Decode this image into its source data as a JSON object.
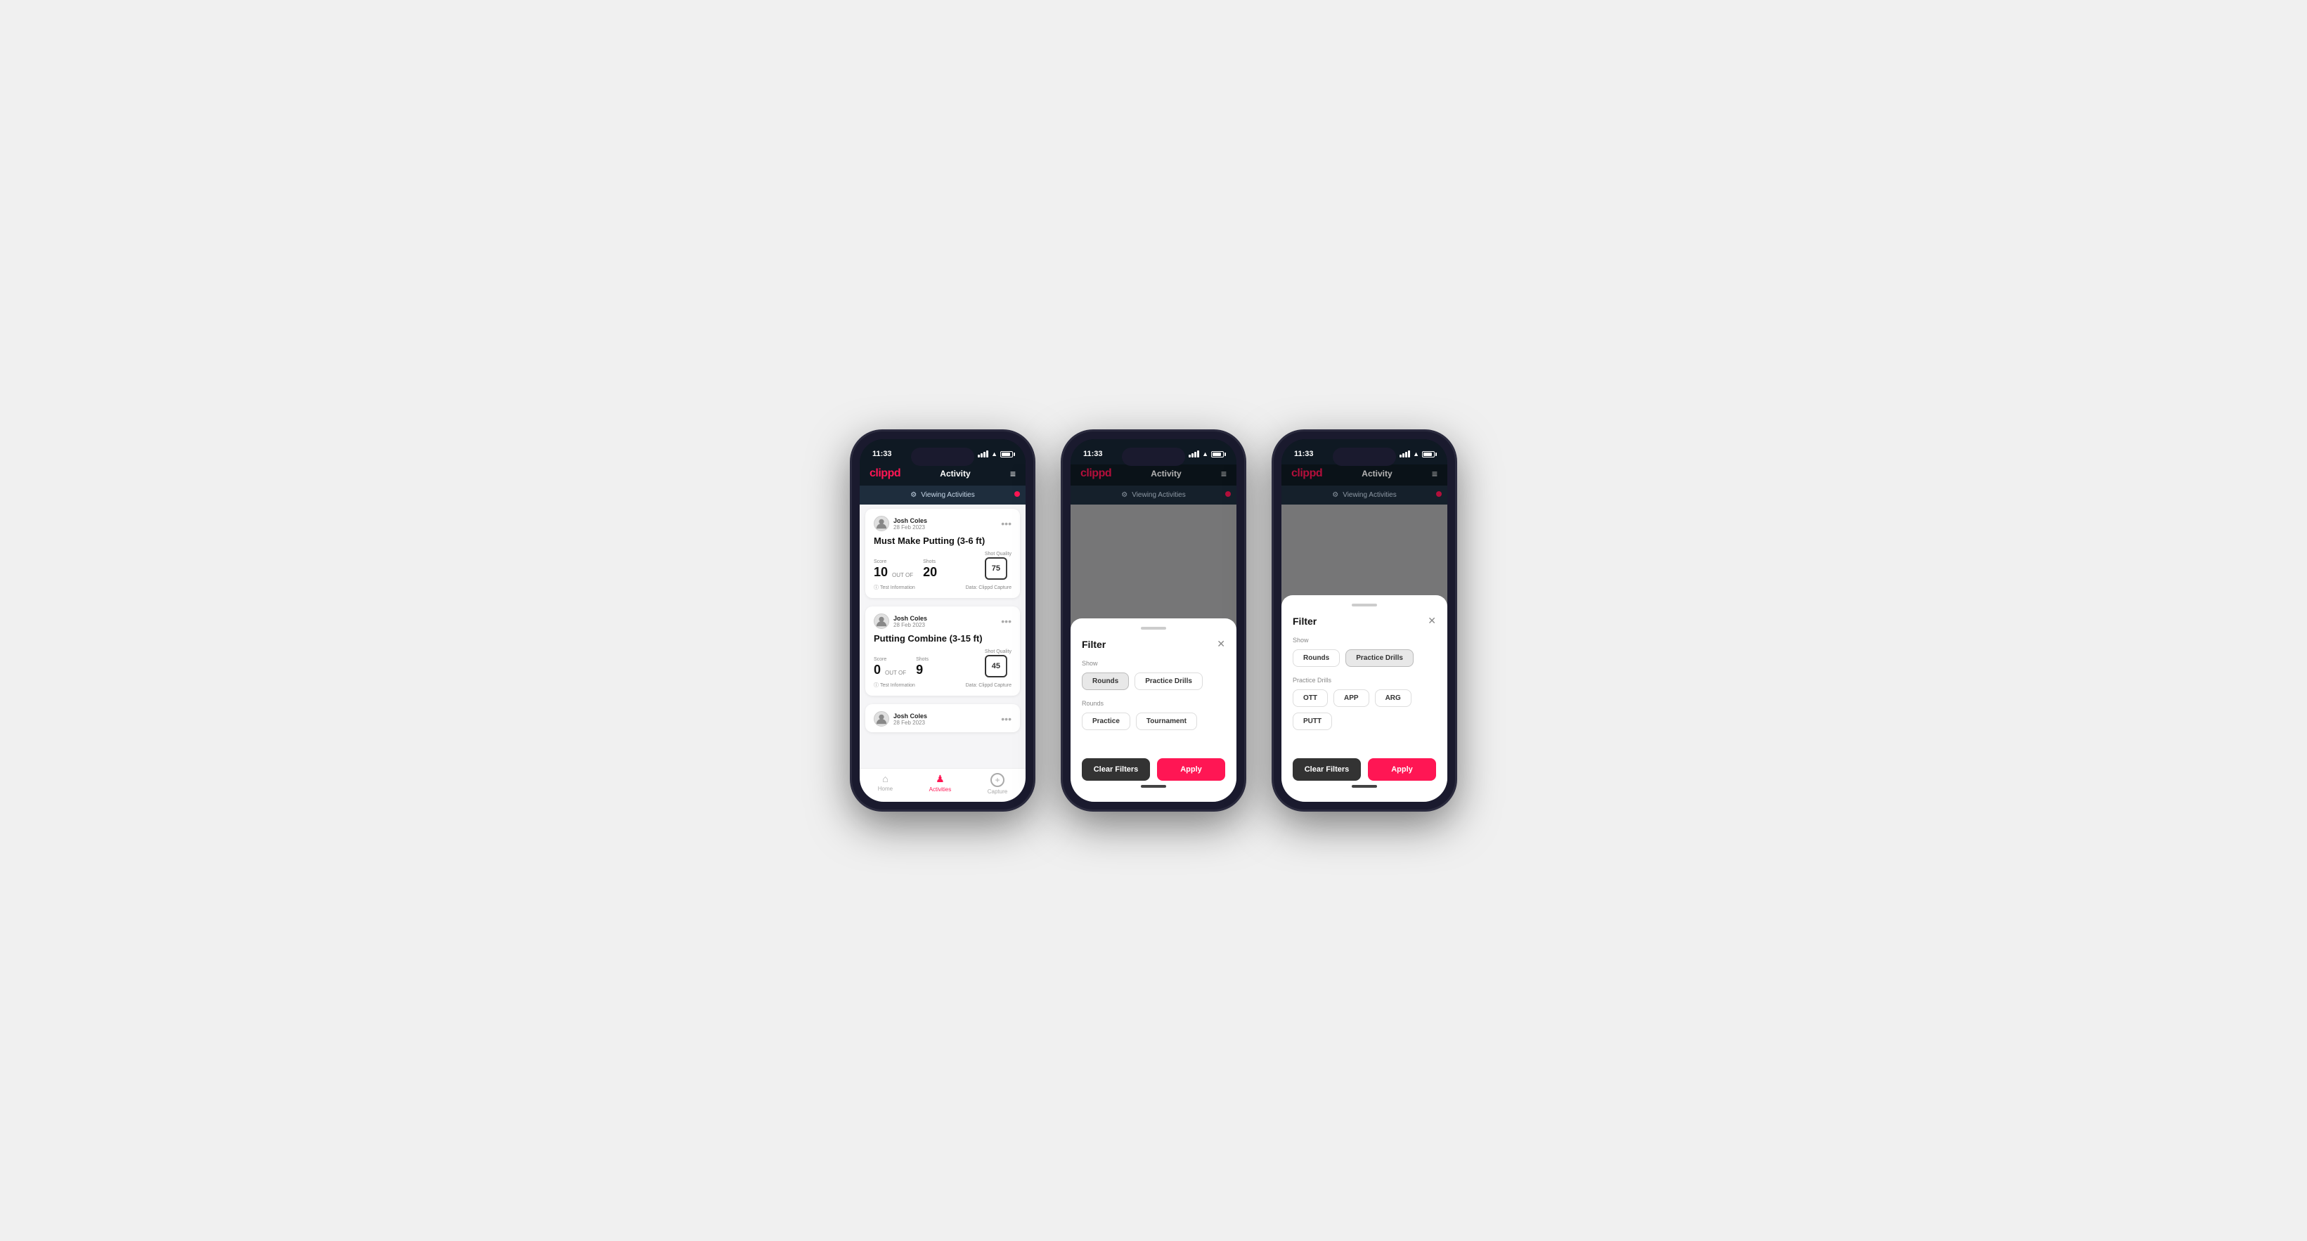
{
  "phones": [
    {
      "id": "phone1",
      "statusBar": {
        "time": "11:33",
        "battery": "81"
      },
      "header": {
        "logo": "clippd",
        "title": "Activity",
        "menuIcon": "≡"
      },
      "viewingBar": {
        "icon": "⚙",
        "text": "Viewing Activities"
      },
      "activities": [
        {
          "user": "Josh Coles",
          "date": "28 Feb 2023",
          "title": "Must Make Putting (3-6 ft)",
          "score": "10",
          "outOf": "OUT OF",
          "shots": "20",
          "shotQuality": "75",
          "scoreLabel": "Score",
          "shotsLabel": "Shots",
          "shotQualityLabel": "Shot Quality",
          "footer": {
            "info": "Test Information",
            "data": "Data: Clippd Capture"
          }
        },
        {
          "user": "Josh Coles",
          "date": "28 Feb 2023",
          "title": "Putting Combine (3-15 ft)",
          "score": "0",
          "outOf": "OUT OF",
          "shots": "9",
          "shotQuality": "45",
          "scoreLabel": "Score",
          "shotsLabel": "Shots",
          "shotQualityLabel": "Shot Quality",
          "footer": {
            "info": "Test Information",
            "data": "Data: Clippd Capture"
          }
        },
        {
          "user": "Josh Coles",
          "date": "28 Feb 2023",
          "title": "",
          "score": "",
          "outOf": "",
          "shots": "",
          "shotQuality": "",
          "scoreLabel": "",
          "shotsLabel": "",
          "shotQualityLabel": "",
          "footer": {
            "info": "",
            "data": ""
          }
        }
      ],
      "bottomNav": [
        {
          "icon": "⌂",
          "label": "Home",
          "active": false
        },
        {
          "icon": "♟",
          "label": "Activities",
          "active": true
        },
        {
          "icon": "+",
          "label": "Capture",
          "active": false
        }
      ]
    },
    {
      "id": "phone2",
      "statusBar": {
        "time": "11:33",
        "battery": "81"
      },
      "header": {
        "logo": "clippd",
        "title": "Activity",
        "menuIcon": "≡"
      },
      "viewingBar": {
        "icon": "⚙",
        "text": "Viewing Activities"
      },
      "filter": {
        "title": "Filter",
        "showLabel": "Show",
        "roundsLabel": "Rounds",
        "showChips": [
          {
            "label": "Rounds",
            "active": true
          },
          {
            "label": "Practice Drills",
            "active": false
          }
        ],
        "roundsChips": [
          {
            "label": "Practice",
            "active": false
          },
          {
            "label": "Tournament",
            "active": false
          }
        ],
        "clearFilters": "Clear Filters",
        "apply": "Apply"
      }
    },
    {
      "id": "phone3",
      "statusBar": {
        "time": "11:33",
        "battery": "81"
      },
      "header": {
        "logo": "clippd",
        "title": "Activity",
        "menuIcon": "≡"
      },
      "viewingBar": {
        "icon": "⚙",
        "text": "Viewing Activities"
      },
      "filter": {
        "title": "Filter",
        "showLabel": "Show",
        "practiceDrillsLabel": "Practice Drills",
        "showChips": [
          {
            "label": "Rounds",
            "active": false
          },
          {
            "label": "Practice Drills",
            "active": true
          }
        ],
        "drillsChips": [
          {
            "label": "OTT",
            "active": false
          },
          {
            "label": "APP",
            "active": false
          },
          {
            "label": "ARG",
            "active": false
          },
          {
            "label": "PUTT",
            "active": false
          }
        ],
        "clearFilters": "Clear Filters",
        "apply": "Apply"
      }
    }
  ]
}
